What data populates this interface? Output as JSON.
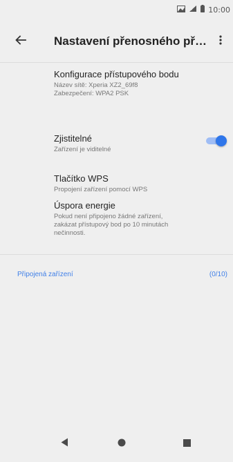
{
  "status_bar": {
    "time": "10:00",
    "icons": [
      "image-notification-icon",
      "signal-icon",
      "battery-icon"
    ]
  },
  "toolbar": {
    "title": "Nastavení přenosného př…",
    "back_icon": "arrow-back-icon",
    "more_icon": "more-vert-icon"
  },
  "preferences": [
    {
      "title": "Konfigurace přístupového bodu",
      "summary_lines": [
        "Název sítě: Xperia XZ2_69f8",
        "Zabezpečení: WPA2 PSK"
      ]
    },
    {
      "title": "Zjistitelné",
      "summary_lines": [
        "Zařízení je viditelné"
      ],
      "toggle_on": true
    },
    {
      "title": "Tlačítko WPS",
      "summary_lines": [
        "Propojení zařízení pomocí WPS"
      ]
    },
    {
      "title": "Úspora energie",
      "summary_lines": [
        "Pokud není připojeno žádné zařízení,",
        "zakázat přístupový bod po 10 minutách",
        "nečinnosti."
      ]
    }
  ],
  "connected_devices": {
    "label": "Připojená zařízení",
    "count": "(0/10)"
  },
  "nav_bar": {
    "icons": [
      "back-triangle-icon",
      "home-circle-icon",
      "recents-square-icon"
    ]
  },
  "colors": {
    "accent": "#3f7fe8",
    "toggle_thumb": "#2f76ea",
    "background": "#efefef"
  }
}
